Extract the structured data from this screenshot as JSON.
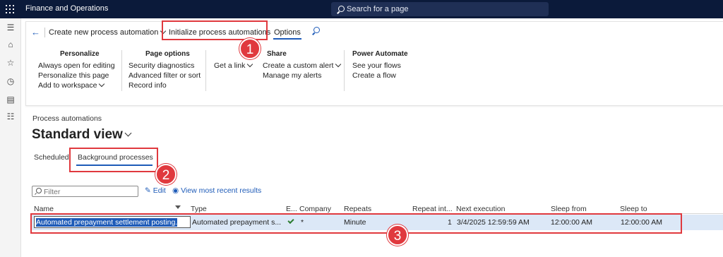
{
  "app": {
    "title": "Finance and Operations",
    "search_placeholder": "Search for a page"
  },
  "action_pane": {
    "tabs": {
      "create": "Create new process automation",
      "initialize": "Initialize process automations",
      "options": "Options"
    },
    "groups": {
      "personalize": {
        "title": "Personalize",
        "items": [
          "Always open for editing",
          "Personalize this page",
          "Add to workspace"
        ]
      },
      "page_options": {
        "title": "Page options",
        "items": [
          "Security diagnostics",
          "Advanced filter or sort",
          "Record info"
        ]
      },
      "get_link": "Get a link",
      "share": {
        "title": "Share",
        "items": [
          "Create a custom alert",
          "Manage my alerts"
        ]
      },
      "power_automate": {
        "title": "Power Automate",
        "items": [
          "See your flows",
          "Create a flow"
        ]
      }
    }
  },
  "content": {
    "breadcrumb": "Process automations",
    "view_title": "Standard view",
    "tabs": {
      "scheduled": "Scheduled",
      "background": "Background processes"
    },
    "filter_placeholder": "Filter",
    "edit_link": "Edit",
    "recent_link": "View most recent results"
  },
  "grid": {
    "columns": {
      "name": "Name",
      "type": "Type",
      "enabled": "E...",
      "company": "Company",
      "repeats": "Repeats",
      "repeat_interval": "Repeat int...",
      "next_execution": "Next execution",
      "sleep_from": "Sleep from",
      "sleep_to": "Sleep to"
    },
    "row": {
      "name": "Automated prepayment settlement posting.",
      "type": "Automated prepayment s...",
      "company": "*",
      "repeats": "Minute",
      "repeat_interval": "1",
      "next_execution": "3/4/2025 12:59:59 AM",
      "sleep_from": "12:00:00 AM",
      "sleep_to": "12:00:00 AM"
    }
  },
  "callouts": {
    "one": "1",
    "two": "2",
    "three": "3"
  },
  "colors": {
    "topbar": "#0b1a3a",
    "accent": "#1e5bb8",
    "callout": "#e0393e",
    "selected_row": "#dce8f7"
  }
}
